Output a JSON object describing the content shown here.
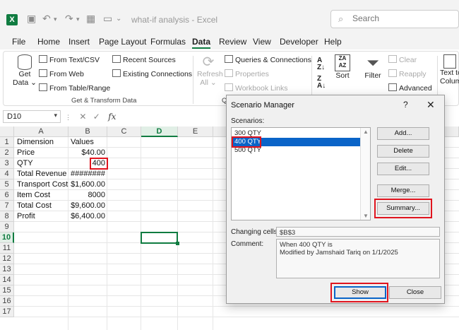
{
  "titlebar": {
    "logo": "X",
    "doc_title": "what-if analysis  -  Excel",
    "search_placeholder": "Search"
  },
  "menu": [
    "File",
    "Home",
    "Insert",
    "Page Layout",
    "Formulas",
    "Data",
    "Review",
    "View",
    "Developer",
    "Help"
  ],
  "menu_active": "Data",
  "ribbon": {
    "get_data": "Get",
    "get_data2": "Data",
    "from_text_csv": "From Text/CSV",
    "from_web": "From Web",
    "from_table_range": "From Table/Range",
    "recent_sources": "Recent Sources",
    "existing_connections": "Existing Connections",
    "group_get_transform": "Get & Transform Data",
    "refresh": "Refresh",
    "refresh_all": "All",
    "queries_connections": "Queries & Connections",
    "properties": "Properties",
    "workbook_links": "Workbook Links",
    "group_queries": "Q",
    "sort": "Sort",
    "filter": "Filter",
    "clear": "Clear",
    "reapply": "Reapply",
    "advanced": "Advanced",
    "text_to_columns": "Text to",
    "text_to_columns2": "Colum"
  },
  "formula_bar": {
    "name_box": "D10",
    "fx": "fx"
  },
  "grid": {
    "columns": [
      "A",
      "B",
      "C",
      "D",
      "E"
    ],
    "rows": [
      "1",
      "2",
      "3",
      "4",
      "5",
      "6",
      "7",
      "8",
      "9",
      "10",
      "11",
      "12",
      "13",
      "14",
      "15",
      "16",
      "17"
    ],
    "cells": [
      {
        "a": "Dimension",
        "b": "Values"
      },
      {
        "a": "Price",
        "b": "$40.00"
      },
      {
        "a": "QTY",
        "b": "400"
      },
      {
        "a": "Total Revenue",
        "b": "########"
      },
      {
        "a": "Transport Cost",
        "b": "$1,600.00"
      },
      {
        "a": "Item Cost",
        "b": "8000"
      },
      {
        "a": "Total Cost",
        "b": "$9,600.00"
      },
      {
        "a": "Profit",
        "b": "$6,400.00"
      }
    ]
  },
  "dialog": {
    "title": "Scenario Manager",
    "help": "?",
    "close": "✕",
    "scenarios_label": "Scenarios:",
    "scenarios": [
      "300 QTY",
      "400 QTY",
      "500 QTY"
    ],
    "selected_scenario": "400 QTY",
    "buttons": {
      "add": "Add...",
      "delete": "Delete",
      "edit": "Edit...",
      "merge": "Merge...",
      "summary": "Summary...",
      "show": "Show",
      "close": "Close"
    },
    "changing_cells_label": "Changing cells:",
    "changing_cells_value": "$B$3",
    "comment_label": "Comment:",
    "comment_line1": "When 400 QTY is",
    "comment_line2": "Modified by Jamshaid Tariq on 1/1/2025"
  },
  "colors": {
    "excel_green": "#107c41",
    "highlight_red": "#e0141e",
    "selection_blue": "#0a64c8"
  }
}
